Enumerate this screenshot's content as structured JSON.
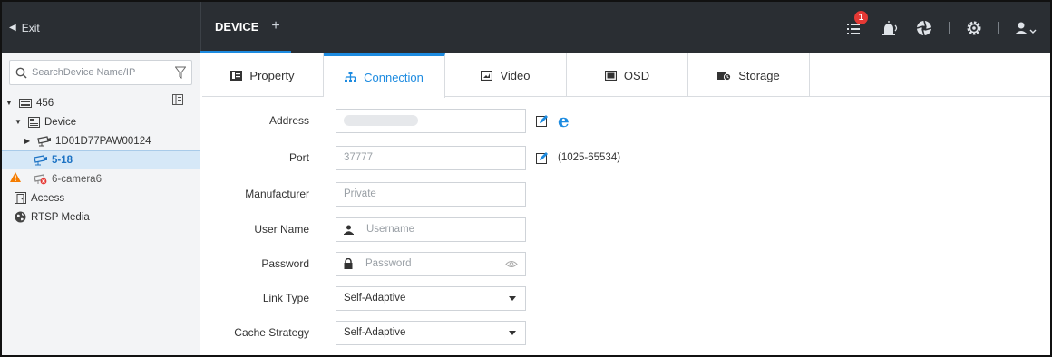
{
  "topbar": {
    "exit_label": "Exit",
    "device_tab": "DEVICE",
    "add_tab": "+",
    "alarm_count": "1"
  },
  "sidebar": {
    "search_placeholder": "SearchDevice Name/IP",
    "tree": {
      "root": "456",
      "device_group": "Device",
      "device_1": "1D01D77PAW00124",
      "device_selected": "5-18",
      "device_warn": "6-camera6",
      "access": "Access",
      "rtsp": "RTSP Media"
    }
  },
  "tabs": [
    {
      "label": "Property",
      "icon": "property-icon"
    },
    {
      "label": "Connection",
      "icon": "connection-icon",
      "active": true
    },
    {
      "label": "Video",
      "icon": "video-icon"
    },
    {
      "label": "OSD",
      "icon": "osd-icon"
    },
    {
      "label": "Storage",
      "icon": "storage-icon"
    }
  ],
  "form": {
    "address": {
      "label": "Address"
    },
    "port": {
      "label": "Port",
      "value": "37777",
      "range": "(1025-65534)"
    },
    "manufacturer": {
      "label": "Manufacturer",
      "value": "Private"
    },
    "username": {
      "label": "User Name",
      "placeholder": "Username"
    },
    "password": {
      "label": "Password",
      "placeholder": "Password"
    },
    "link_type": {
      "label": "Link Type",
      "value": "Self-Adaptive"
    },
    "cache_strategy": {
      "label": "Cache Strategy",
      "value": "Self-Adaptive"
    }
  },
  "colors": {
    "accent": "#1d8be0",
    "topbar": "#2a2e33",
    "badge": "#e53935",
    "warning": "#f57c00",
    "selection": "#d6e8f7"
  }
}
